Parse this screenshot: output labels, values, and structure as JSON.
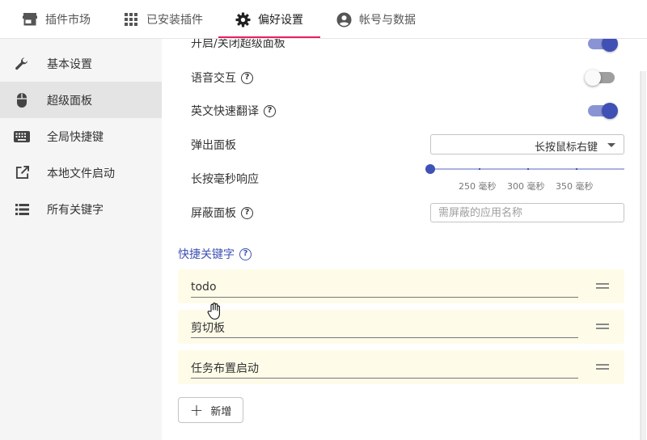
{
  "tabs": [
    {
      "label": "插件市场",
      "icon": "store-icon"
    },
    {
      "label": "已安装插件",
      "icon": "apps-grid-icon"
    },
    {
      "label": "偏好设置",
      "icon": "gear-icon"
    },
    {
      "label": "帐号与数据",
      "icon": "account-circle-icon"
    }
  ],
  "active_tab": "偏好设置",
  "sidebar": {
    "items": [
      {
        "label": "基本设置",
        "icon": "wrench-icon"
      },
      {
        "label": "超级面板",
        "icon": "mouse-icon"
      },
      {
        "label": "全局快捷键",
        "icon": "keyboard-icon"
      },
      {
        "label": "本地文件启动",
        "icon": "open-in-new-icon"
      },
      {
        "label": "所有关键字",
        "icon": "list-icon"
      }
    ],
    "active": "超级面板"
  },
  "settings": {
    "toggle_panel_label": "开启/关闭超级面板",
    "toggle_panel_on": true,
    "voice_label": "语音交互",
    "voice_on": false,
    "translate_label": "英文快速翻译",
    "translate_on": true,
    "popup_label": "弹出面板",
    "popup_value": "长按鼠标右键",
    "longpress_label": "长按毫秒响应",
    "longpress_value": 200,
    "longpress_marks": [
      "250 毫秒",
      "300 毫秒",
      "350 毫秒"
    ],
    "block_label": "屏蔽面板",
    "block_placeholder": "需屏蔽的应用名称",
    "help_glyph": "?"
  },
  "shortcuts": {
    "title": "快捷关键字",
    "items": [
      "todo",
      "剪切板",
      "任务布置启动"
    ],
    "add_label": "新增",
    "add_glyph": "+"
  },
  "colors": {
    "accent": "#3f51b5",
    "tab_indicator": "#e91e63",
    "card_bg": "#fefce8"
  }
}
